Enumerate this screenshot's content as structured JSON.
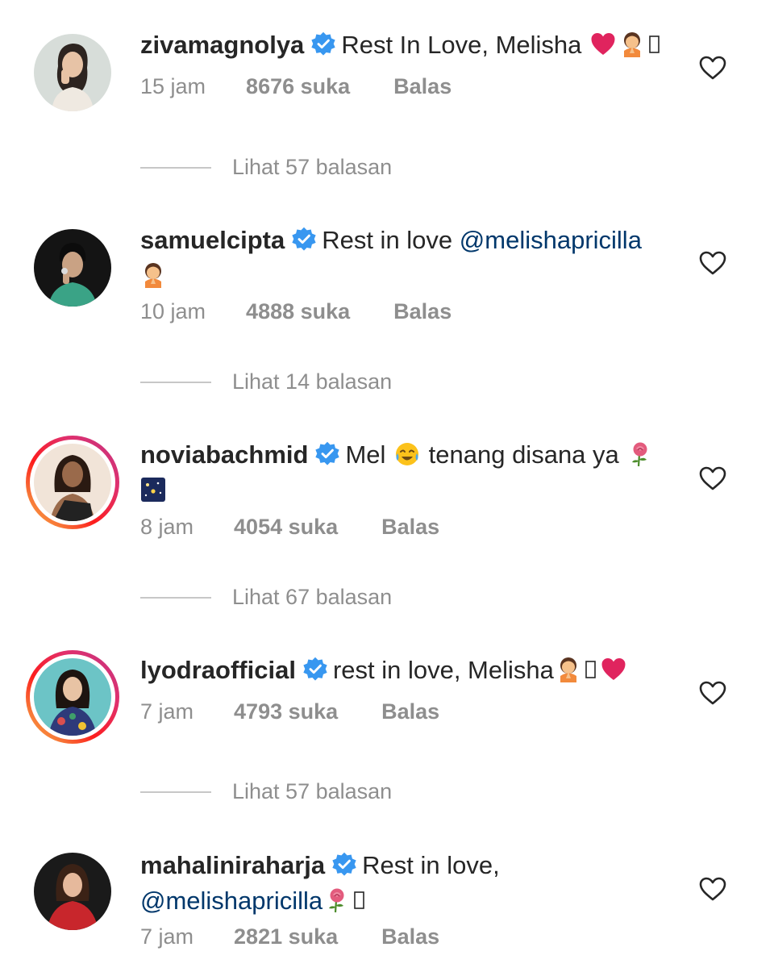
{
  "comments": [
    {
      "username": "zivamagnolya",
      "text": "Rest In Love, Melisha",
      "time": "15 jam",
      "likes": "8676 suka",
      "reply": "Balas",
      "view_replies": "Lihat 57 balasan"
    },
    {
      "username": "samuelcipta",
      "text": "Rest in love",
      "mention": "@melishapricilla",
      "time": "10 jam",
      "likes": "4888 suka",
      "reply": "Balas",
      "view_replies": "Lihat 14 balasan"
    },
    {
      "username": "noviabachmid",
      "text_before": "Mel",
      "text_after": "tenang disana ya",
      "time": "8 jam",
      "likes": "4054 suka",
      "reply": "Balas",
      "view_replies": "Lihat 67 balasan"
    },
    {
      "username": "lyodraofficial",
      "text": "rest in love, Melisha",
      "time": "7 jam",
      "likes": "4793 suka",
      "reply": "Balas",
      "view_replies": "Lihat 57 balasan"
    },
    {
      "username": "mahaliniraharja",
      "text": "Rest in love,",
      "mention": "@melishapricilla",
      "time": "7 jam",
      "likes": "2821 suka",
      "reply": "Balas"
    }
  ],
  "icons": {
    "verified": "verified-badge-icon",
    "heart": "heart-outline-icon",
    "emoji_red_heart": "red-heart-emoji-icon",
    "emoji_praying_person": "praying-person-emoji-icon",
    "emoji_crying_face": "crying-face-emoji-icon",
    "emoji_rose": "rose-emoji-icon",
    "emoji_night_sky": "night-sky-emoji-icon",
    "emoji_missing_glyph": "missing-glyph-icon"
  },
  "colors": {
    "text": "#262626",
    "secondary": "#8e8e8e",
    "mention": "#00376b",
    "verified": "#3897f0",
    "divider": "#c7c7c7"
  }
}
